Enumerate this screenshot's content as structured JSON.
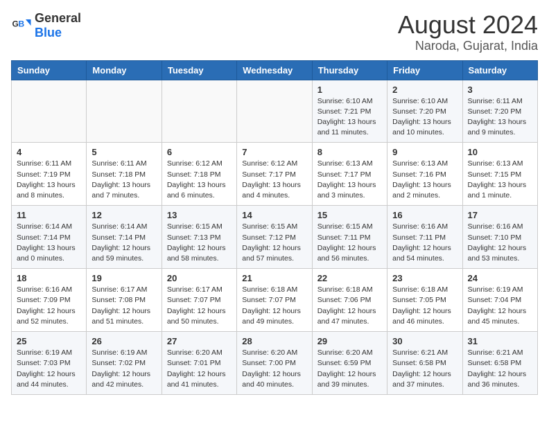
{
  "header": {
    "logo_general": "General",
    "logo_blue": "Blue",
    "title": "August 2024",
    "subtitle": "Naroda, Gujarat, India"
  },
  "weekdays": [
    "Sunday",
    "Monday",
    "Tuesday",
    "Wednesday",
    "Thursday",
    "Friday",
    "Saturday"
  ],
  "weeks": [
    [
      {
        "day": "",
        "info": ""
      },
      {
        "day": "",
        "info": ""
      },
      {
        "day": "",
        "info": ""
      },
      {
        "day": "",
        "info": ""
      },
      {
        "day": "1",
        "info": "Sunrise: 6:10 AM\nSunset: 7:21 PM\nDaylight: 13 hours\nand 11 minutes."
      },
      {
        "day": "2",
        "info": "Sunrise: 6:10 AM\nSunset: 7:20 PM\nDaylight: 13 hours\nand 10 minutes."
      },
      {
        "day": "3",
        "info": "Sunrise: 6:11 AM\nSunset: 7:20 PM\nDaylight: 13 hours\nand 9 minutes."
      }
    ],
    [
      {
        "day": "4",
        "info": "Sunrise: 6:11 AM\nSunset: 7:19 PM\nDaylight: 13 hours\nand 8 minutes."
      },
      {
        "day": "5",
        "info": "Sunrise: 6:11 AM\nSunset: 7:18 PM\nDaylight: 13 hours\nand 7 minutes."
      },
      {
        "day": "6",
        "info": "Sunrise: 6:12 AM\nSunset: 7:18 PM\nDaylight: 13 hours\nand 6 minutes."
      },
      {
        "day": "7",
        "info": "Sunrise: 6:12 AM\nSunset: 7:17 PM\nDaylight: 13 hours\nand 4 minutes."
      },
      {
        "day": "8",
        "info": "Sunrise: 6:13 AM\nSunset: 7:17 PM\nDaylight: 13 hours\nand 3 minutes."
      },
      {
        "day": "9",
        "info": "Sunrise: 6:13 AM\nSunset: 7:16 PM\nDaylight: 13 hours\nand 2 minutes."
      },
      {
        "day": "10",
        "info": "Sunrise: 6:13 AM\nSunset: 7:15 PM\nDaylight: 13 hours\nand 1 minute."
      }
    ],
    [
      {
        "day": "11",
        "info": "Sunrise: 6:14 AM\nSunset: 7:14 PM\nDaylight: 13 hours\nand 0 minutes."
      },
      {
        "day": "12",
        "info": "Sunrise: 6:14 AM\nSunset: 7:14 PM\nDaylight: 12 hours\nand 59 minutes."
      },
      {
        "day": "13",
        "info": "Sunrise: 6:15 AM\nSunset: 7:13 PM\nDaylight: 12 hours\nand 58 minutes."
      },
      {
        "day": "14",
        "info": "Sunrise: 6:15 AM\nSunset: 7:12 PM\nDaylight: 12 hours\nand 57 minutes."
      },
      {
        "day": "15",
        "info": "Sunrise: 6:15 AM\nSunset: 7:11 PM\nDaylight: 12 hours\nand 56 minutes."
      },
      {
        "day": "16",
        "info": "Sunrise: 6:16 AM\nSunset: 7:11 PM\nDaylight: 12 hours\nand 54 minutes."
      },
      {
        "day": "17",
        "info": "Sunrise: 6:16 AM\nSunset: 7:10 PM\nDaylight: 12 hours\nand 53 minutes."
      }
    ],
    [
      {
        "day": "18",
        "info": "Sunrise: 6:16 AM\nSunset: 7:09 PM\nDaylight: 12 hours\nand 52 minutes."
      },
      {
        "day": "19",
        "info": "Sunrise: 6:17 AM\nSunset: 7:08 PM\nDaylight: 12 hours\nand 51 minutes."
      },
      {
        "day": "20",
        "info": "Sunrise: 6:17 AM\nSunset: 7:07 PM\nDaylight: 12 hours\nand 50 minutes."
      },
      {
        "day": "21",
        "info": "Sunrise: 6:18 AM\nSunset: 7:07 PM\nDaylight: 12 hours\nand 49 minutes."
      },
      {
        "day": "22",
        "info": "Sunrise: 6:18 AM\nSunset: 7:06 PM\nDaylight: 12 hours\nand 47 minutes."
      },
      {
        "day": "23",
        "info": "Sunrise: 6:18 AM\nSunset: 7:05 PM\nDaylight: 12 hours\nand 46 minutes."
      },
      {
        "day": "24",
        "info": "Sunrise: 6:19 AM\nSunset: 7:04 PM\nDaylight: 12 hours\nand 45 minutes."
      }
    ],
    [
      {
        "day": "25",
        "info": "Sunrise: 6:19 AM\nSunset: 7:03 PM\nDaylight: 12 hours\nand 44 minutes."
      },
      {
        "day": "26",
        "info": "Sunrise: 6:19 AM\nSunset: 7:02 PM\nDaylight: 12 hours\nand 42 minutes."
      },
      {
        "day": "27",
        "info": "Sunrise: 6:20 AM\nSunset: 7:01 PM\nDaylight: 12 hours\nand 41 minutes."
      },
      {
        "day": "28",
        "info": "Sunrise: 6:20 AM\nSunset: 7:00 PM\nDaylight: 12 hours\nand 40 minutes."
      },
      {
        "day": "29",
        "info": "Sunrise: 6:20 AM\nSunset: 6:59 PM\nDaylight: 12 hours\nand 39 minutes."
      },
      {
        "day": "30",
        "info": "Sunrise: 6:21 AM\nSunset: 6:58 PM\nDaylight: 12 hours\nand 37 minutes."
      },
      {
        "day": "31",
        "info": "Sunrise: 6:21 AM\nSunset: 6:58 PM\nDaylight: 12 hours\nand 36 minutes."
      }
    ]
  ]
}
